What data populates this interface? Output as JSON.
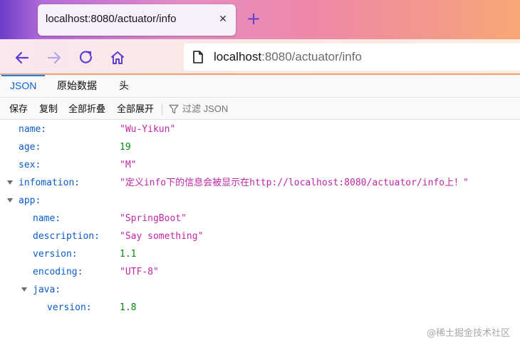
{
  "browser": {
    "tab_title": "localhost:8080/actuator/info",
    "url_host": "localhost",
    "url_rest": ":8080/actuator/info"
  },
  "viewer_tabs": [
    "JSON",
    "原始数据",
    "头"
  ],
  "toolbar": {
    "save": "保存",
    "copy": "复制",
    "collapse_all": "全部折叠",
    "expand_all": "全部展开",
    "filter_placeholder": "过滤 JSON"
  },
  "json": {
    "name": {
      "key": "name:",
      "value": "\"Wu-Yikun\""
    },
    "age": {
      "key": "age:",
      "value": "19"
    },
    "sex": {
      "key": "sex:",
      "value": "\"M\""
    },
    "infomation": {
      "key": "infomation:",
      "value": "\"定义info下的信息会被显示在http://localhost:8080/actuator/info上！\""
    },
    "app": {
      "key": "app:",
      "name": {
        "key": "name:",
        "value": "\"SpringBoot\""
      },
      "description": {
        "key": "description:",
        "value": "\"Say something\""
      },
      "version": {
        "key": "version:",
        "value": "1.1"
      },
      "encoding": {
        "key": "encoding:",
        "value": "\"UTF-8\""
      },
      "java": {
        "key": "java:",
        "version": {
          "key": "version:",
          "value": "1.8"
        }
      }
    }
  },
  "watermark": "@稀土掘金技术社区",
  "colors": {
    "key": "#0b5bc7",
    "string": "#c026a6",
    "number": "#068a0e",
    "active_tab": "#0a84ff"
  }
}
